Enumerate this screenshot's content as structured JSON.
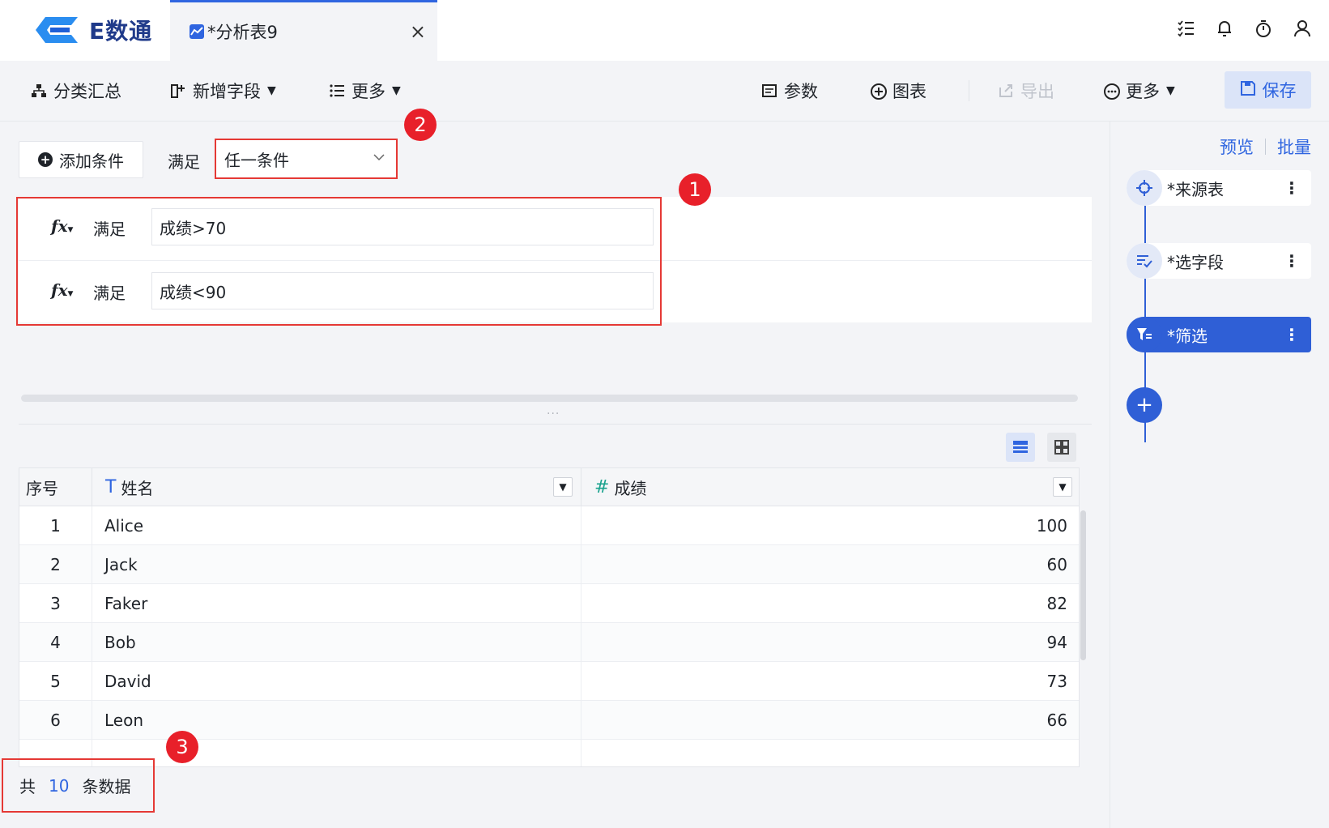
{
  "app": {
    "name": "E数通",
    "tab_title": "*分析表9",
    "tab_close": "×"
  },
  "toolbar": {
    "category_summary": "分类汇总",
    "add_field": "新增字段",
    "more_left": "更多",
    "params": "参数",
    "chart": "图表",
    "export": "导出",
    "more_right": "更多",
    "save": "保存"
  },
  "filter": {
    "add_condition": "添加条件",
    "satisfy": "满足",
    "mode_value": "任一条件",
    "conditions": [
      {
        "label": "满足",
        "expr": "成绩>70"
      },
      {
        "label": "满足",
        "expr": "成绩<90"
      }
    ]
  },
  "table": {
    "headers": [
      "序号",
      "姓名",
      "成绩"
    ],
    "type_icons": [
      "T",
      "#"
    ],
    "rows": [
      {
        "idx": "1",
        "name": "Alice",
        "score": "100"
      },
      {
        "idx": "2",
        "name": "Jack",
        "score": "60"
      },
      {
        "idx": "3",
        "name": "Faker",
        "score": "82"
      },
      {
        "idx": "4",
        "name": "Bob",
        "score": "94"
      },
      {
        "idx": "5",
        "name": "David",
        "score": "73"
      },
      {
        "idx": "6",
        "name": "Leon",
        "score": "66"
      }
    ]
  },
  "footer": {
    "prefix": "共",
    "count": "10",
    "suffix": "条数据"
  },
  "right_panel": {
    "preview": "预览",
    "batch": "批量",
    "nodes": [
      {
        "label": "*来源表",
        "icon": "crosshair-icon"
      },
      {
        "label": "*选字段",
        "icon": "field-select-icon"
      },
      {
        "label": "*筛选",
        "icon": "filter-icon"
      }
    ]
  },
  "badges": [
    "1",
    "2",
    "3"
  ],
  "colors": {
    "accent": "#2f65e0",
    "highlight": "#e53935",
    "badge": "#e8202a"
  }
}
